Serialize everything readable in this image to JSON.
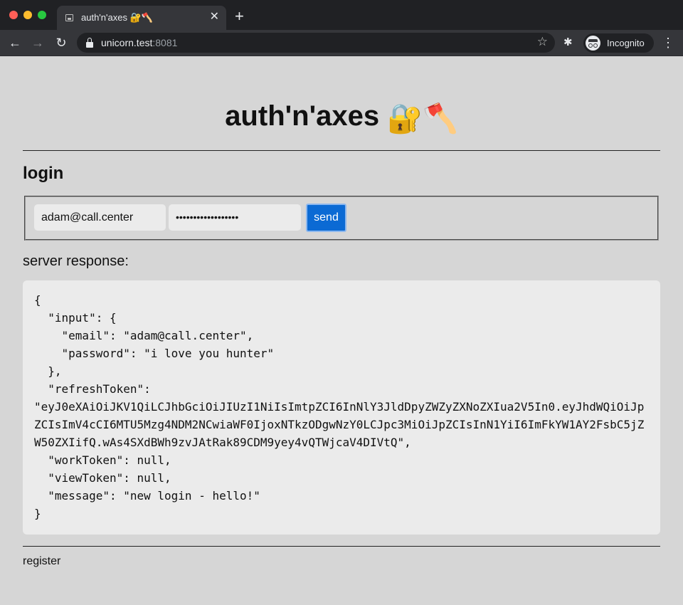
{
  "browser": {
    "tab_title": "auth'n'axes 🔐🪓",
    "tab_close": "✕",
    "new_tab": "+",
    "url_host": "unicorn.test",
    "url_port": ":8081",
    "incognito_label": "Incognito"
  },
  "page": {
    "title": "auth'n'axes",
    "title_emoji": "🔐🪓",
    "login_heading": "login",
    "form": {
      "email_value": "adam@call.center",
      "password_masked": "••••••••••••••••••",
      "send_label": "send"
    },
    "response_label": "server response:",
    "response_text": "{\n  \"input\": {\n    \"email\": \"adam@call.center\",\n    \"password\": \"i love you hunter\"\n  },\n  \"refreshToken\":\n\"eyJ0eXAiOiJKV1QiLCJhbGciOiJIUzI1NiIsImtpZCI6InNlY3JldDpyZWZyZXNoZXIua2V5In0.eyJhdWQiOiJpZCIsImV4cCI6MTU5Mzg4NDM2NCwiaWF0IjoxNTkzODgwNzY0LCJpc3MiOiJpZCIsInN1YiI6ImFkYW1AY2FsbC5jZW50ZXIifQ.wAs4SXdBWh9zvJAtRak89CDM9yey4vQTWjcaV4DIVtQ\",\n  \"workToken\": null,\n  \"viewToken\": null,\n  \"message\": \"new login - hello!\"\n}",
    "register_link": "register"
  }
}
